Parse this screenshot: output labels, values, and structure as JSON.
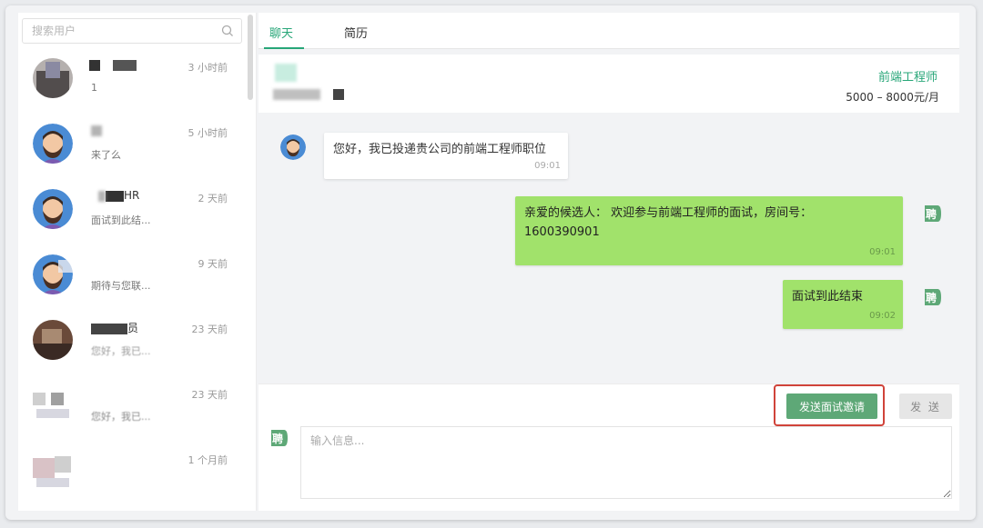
{
  "search": {
    "placeholder": "搜索用户"
  },
  "contacts": [
    {
      "time": "3 小时前",
      "preview": "1"
    },
    {
      "time": "5 小时前",
      "preview": "来了么"
    },
    {
      "name_suffix": "HR",
      "time": "2 天前",
      "preview": "面试到此结..."
    },
    {
      "time": "9 天前",
      "preview": "期待与您联..."
    },
    {
      "name_suffix": "员",
      "time": "23 天前",
      "preview": "您好，我已..."
    },
    {
      "time": "23 天前",
      "preview": "您好，我已..."
    },
    {
      "time": "1 个月前",
      "preview": ""
    }
  ],
  "tabs": {
    "chat": "聊天",
    "resume": "简历"
  },
  "job": {
    "title": "前端工程师",
    "salary": "5000 – 8000元/月"
  },
  "messages": [
    {
      "from": "candidate",
      "text": "您好，我已投递贵公司的前端工程师职位",
      "time": "09:01"
    },
    {
      "from": "recruiter",
      "line1": "亲爱的候选人：  欢迎参与前端工程师的面试，房间号：",
      "line2": "1600390901",
      "time": "09:01"
    },
    {
      "from": "recruiter",
      "text": "面试到此结束",
      "time": "09:02"
    }
  ],
  "composer": {
    "invite_label": "发送面试邀请",
    "send_label": "发 送",
    "placeholder": "输入信息..."
  },
  "colors": {
    "accent": "#27a678",
    "bubble_out": "#a1e26b",
    "highlight": "#d0433a"
  },
  "icons": {
    "search": "search-icon",
    "brand": "zhaopin-logo-icon"
  }
}
